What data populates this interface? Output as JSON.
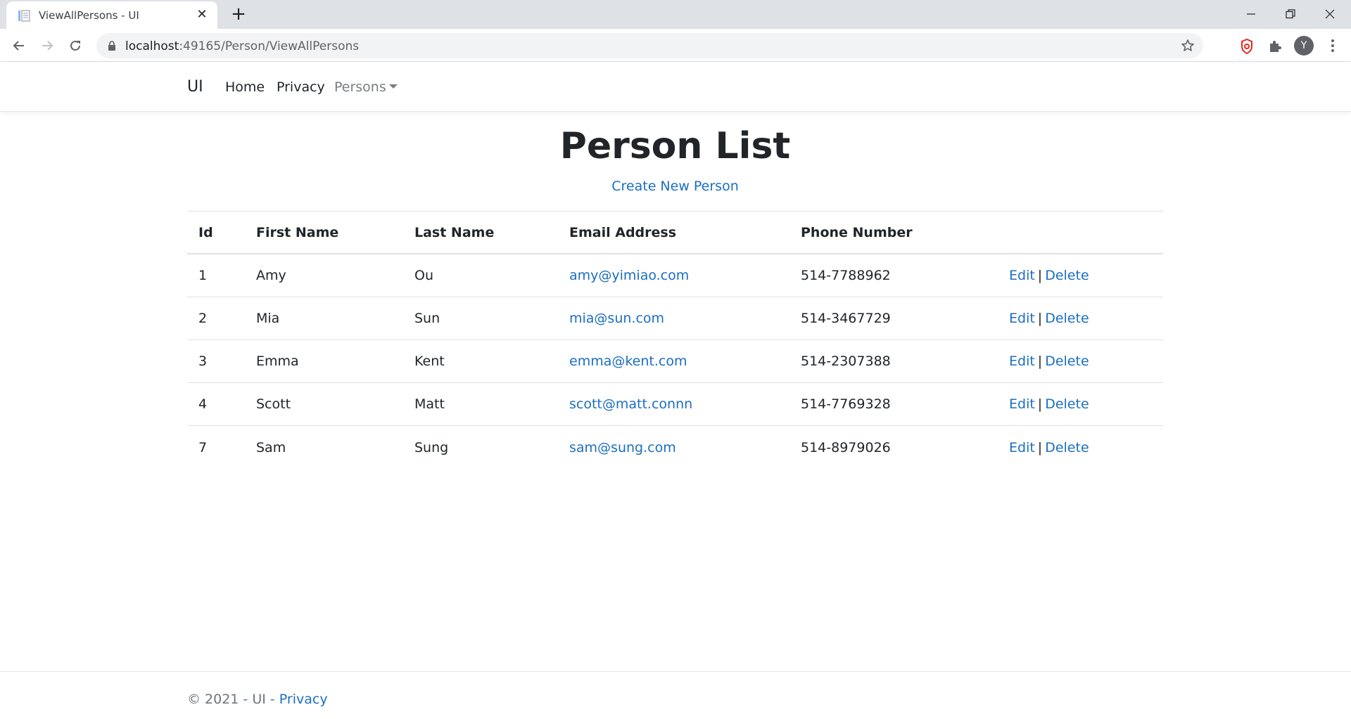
{
  "browser": {
    "tab_title": "ViewAllPersons - UI",
    "tab_close_glyph": "✕",
    "new_tab_glyph": "+",
    "url_host": "localhost",
    "url_path": ":49165/Person/ViewAllPersons",
    "profile_initial": "Y",
    "icons": [
      "back-arrow-icon",
      "forward-arrow-icon",
      "reload-icon",
      "lock-icon",
      "star-icon",
      "extension-shield-icon",
      "puzzle-icon",
      "more-vert-icon",
      "minimize-icon",
      "restore-icon",
      "close-window-icon"
    ]
  },
  "navbar": {
    "brand": "UI",
    "links": [
      {
        "label": "Home"
      },
      {
        "label": "Privacy"
      },
      {
        "label": "Persons"
      }
    ]
  },
  "main": {
    "title": "Person List",
    "create_link": "Create New Person",
    "table": {
      "headers": [
        "Id",
        "First Name",
        "Last Name",
        "Email Address",
        "Phone Number"
      ],
      "rows": [
        {
          "id": "1",
          "first": "Amy",
          "last": "Ou",
          "email": "amy@yimiao.com",
          "phone": "514-7788962"
        },
        {
          "id": "2",
          "first": "Mia",
          "last": "Sun",
          "email": "mia@sun.com",
          "phone": "514-3467729"
        },
        {
          "id": "3",
          "first": "Emma",
          "last": "Kent",
          "email": "emma@kent.com",
          "phone": "514-2307388"
        },
        {
          "id": "4",
          "first": "Scott",
          "last": "Matt",
          "email": "scott@matt.connn",
          "phone": "514-7769328"
        },
        {
          "id": "7",
          "first": "Sam",
          "last": "Sung",
          "email": "sam@sung.com",
          "phone": "514-8979026"
        }
      ],
      "edit_label": "Edit",
      "separator": "|",
      "delete_label": "Delete"
    }
  },
  "footer": {
    "text": "© 2021 - UI - ",
    "privacy_link": "Privacy"
  },
  "colors": {
    "link": "#1b6ec2",
    "text": "#212529",
    "muted": "#6c757d",
    "chrome_bg": "#dee1e6"
  }
}
